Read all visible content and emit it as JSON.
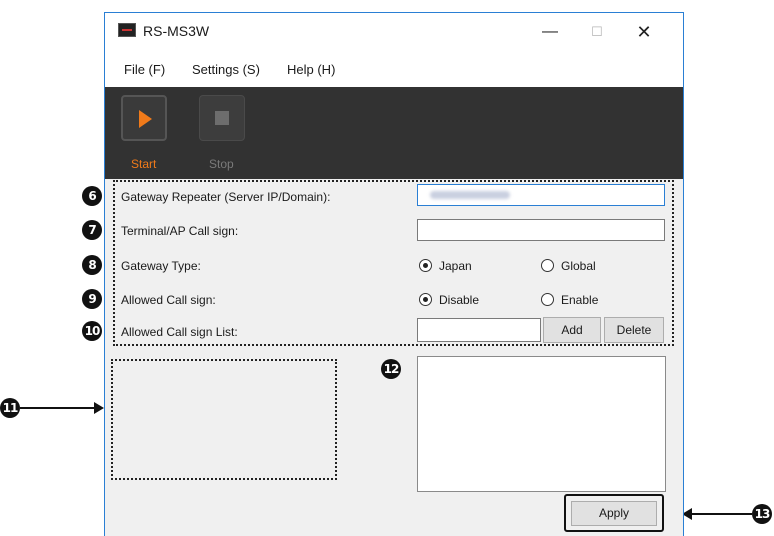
{
  "window": {
    "title": "RS-MS3W",
    "app_icon": "app-logo-icon"
  },
  "window_controls": {
    "minimize": "—",
    "maximize": "☐",
    "close": "✕"
  },
  "menu": [
    {
      "label": "File (F)"
    },
    {
      "label": "Settings (S)"
    },
    {
      "label": "Help (H)"
    }
  ],
  "toolbar": {
    "start_label": "Start",
    "stop_label": "Stop",
    "accent_color": "#f07a1a",
    "background": "#323232"
  },
  "form": {
    "gateway_repeater_label": "Gateway Repeater (Server IP/Domain):",
    "terminal_callsign_label": "Terminal/AP Call sign:",
    "gateway_type_label": "Gateway Type:",
    "gateway_type_options": [
      "Japan",
      "Global"
    ],
    "gateway_type_selected": "Japan",
    "allowed_callsign_label": "Allowed Call sign:",
    "allowed_callsign_options": [
      "Disable",
      "Enable"
    ],
    "allowed_callsign_selected": "Disable",
    "allowed_list_label": "Allowed Call sign List:",
    "terminal_callsign_value": "",
    "allowed_list_value": "",
    "add_button": "Add",
    "delete_button": "Delete",
    "apply_button": "Apply"
  },
  "callouts": {
    "c6": "6",
    "c7": "7",
    "c8": "8",
    "c9": "9",
    "c10": "10",
    "c11": "11",
    "c12": "12",
    "c13": "13"
  }
}
